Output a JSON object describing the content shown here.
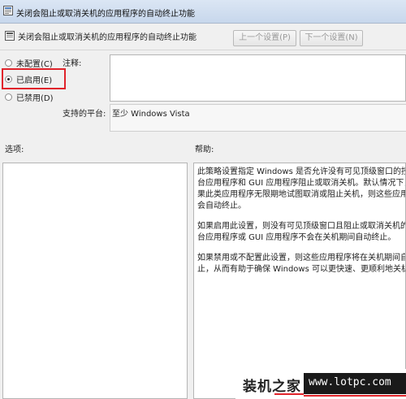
{
  "window": {
    "title": "关闭会阻止或取消关机的应用程序的自动终止功能",
    "accent": "#c7d7ec"
  },
  "header": {
    "policy_title": "关闭会阻止或取消关机的应用程序的自动终止功能",
    "prev_button": "上一个设置(P)",
    "next_button": "下一个设置(N)"
  },
  "state": {
    "options": [
      {
        "label": "未配置(C)",
        "selected": false
      },
      {
        "label": "已启用(E)",
        "selected": true
      },
      {
        "label": "已禁用(D)",
        "selected": false
      }
    ],
    "highlight_color": "#e0242b"
  },
  "comment": {
    "label": "注释:",
    "value": ""
  },
  "platform": {
    "label": "支持的平台:",
    "value": "至少 Windows Vista"
  },
  "options_section": {
    "label": "选项:"
  },
  "help_section": {
    "label": "帮助:",
    "paragraphs": [
      "此策略设置指定 Windows 是否允许没有可见顶级窗口的控制台应用程序和 GUI 应用程序阻止或取消关机。默认情况下，如果此类应用程序无限期地试图取消或阻止关机，则这些应用程序会自动终止。",
      "如果启用此设置，则没有可见顶级窗口且阻止或取消关机的控制台应用程序或 GUI 应用程序不会在关机期间自动终止。",
      "如果禁用或不配置此设置，则这些应用程序将在关机期间自动终止，从而有助于确保 Windows 可以更快速、更顺利地关机。"
    ]
  },
  "watermark": {
    "brand": "装机之家",
    "url": "www.lotpc.com"
  }
}
